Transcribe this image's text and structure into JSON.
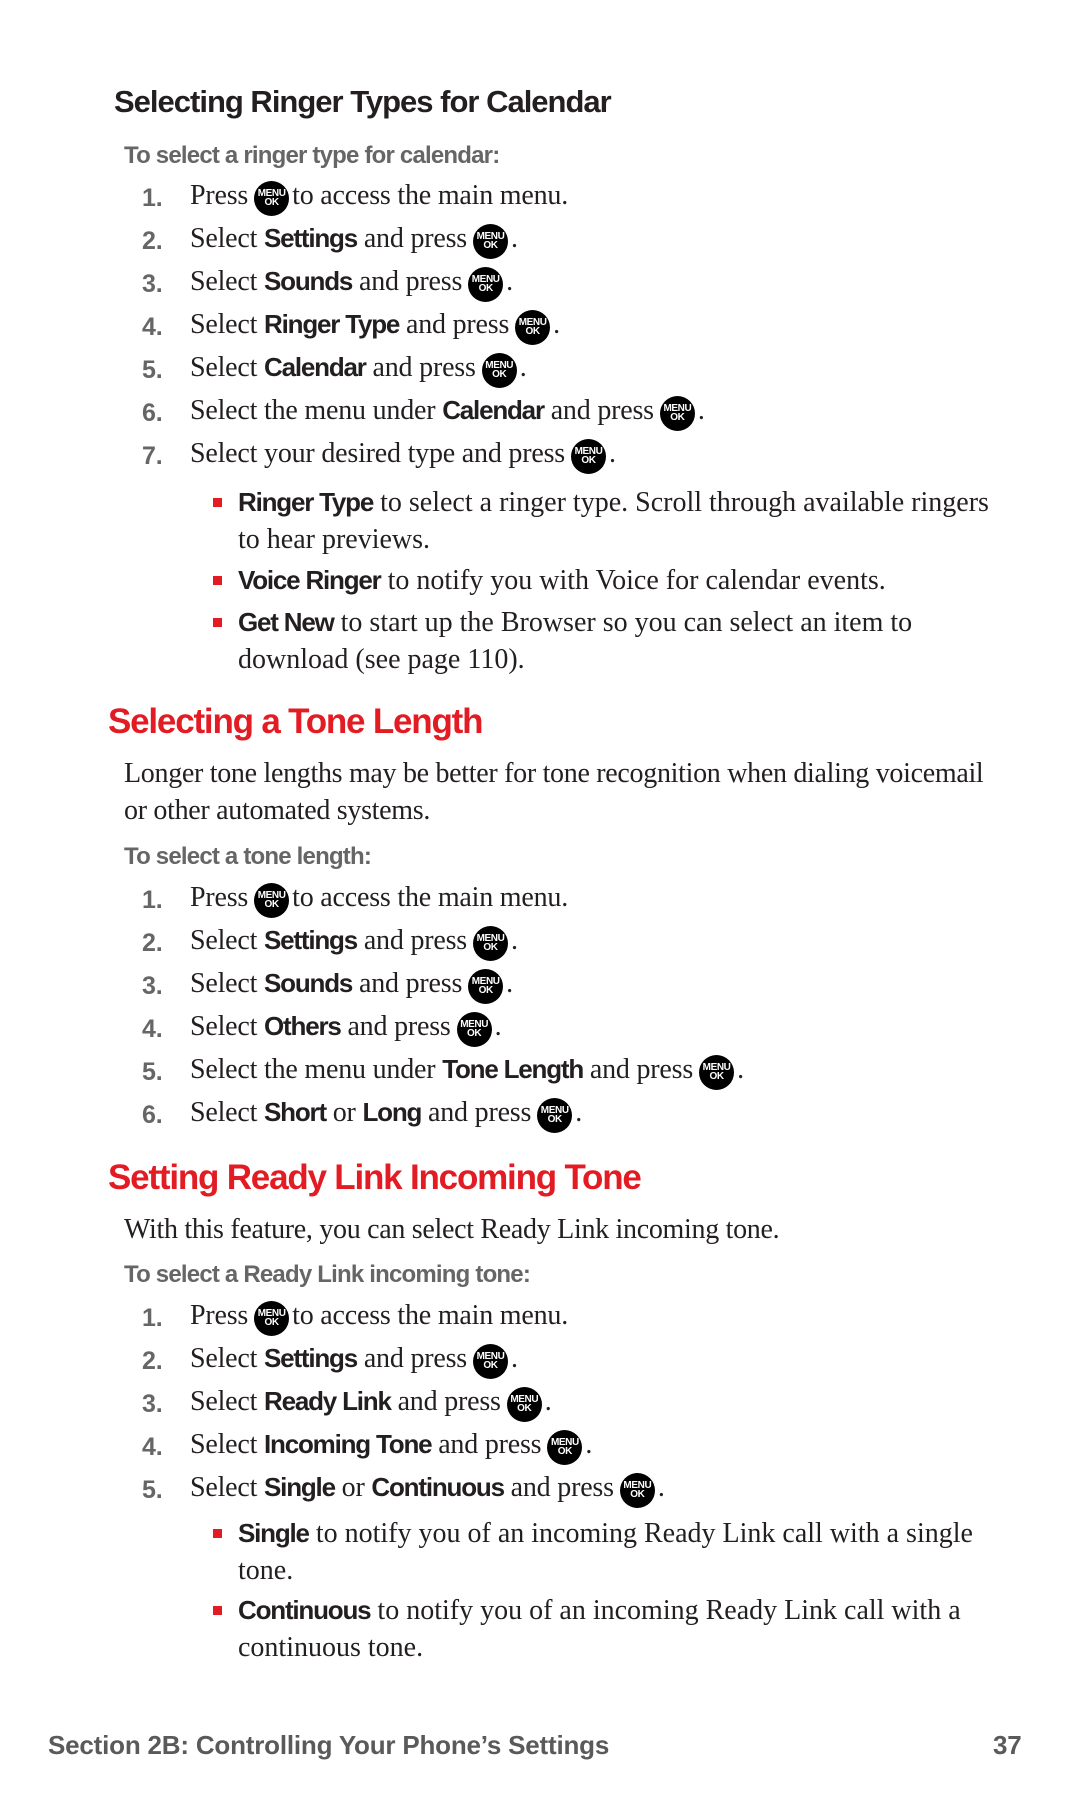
{
  "sections": [
    {
      "title": "Selecting Ringer Types for Calendar",
      "lead": "To select a ringer type for calendar:",
      "steps": [
        {
          "num": "1.",
          "pre": "Press",
          "kw1": "",
          "mid": "",
          "kw2": "",
          "post": "to access the main menu.",
          "end": ""
        },
        {
          "num": "2.",
          "pre": "Select",
          "kw1": "Settings",
          "mid": "",
          "kw2": "",
          "post": "and press",
          "end": "."
        },
        {
          "num": "3.",
          "pre": "Select",
          "kw1": "Sounds",
          "mid": "",
          "kw2": "",
          "post": "and press",
          "end": "."
        },
        {
          "num": "4.",
          "pre": "Select",
          "kw1": "Ringer Type",
          "mid": "",
          "kw2": "",
          "post": "and press",
          "end": "."
        },
        {
          "num": "5.",
          "pre": "Select",
          "kw1": "Calendar",
          "mid": "",
          "kw2": "",
          "post": "and press",
          "end": "."
        },
        {
          "num": "6.",
          "pre": "Select the menu under",
          "kw1": "Calendar",
          "mid": "",
          "kw2": "",
          "post": "and press",
          "end": "."
        },
        {
          "num": "7.",
          "pre": "Select your desired type and press",
          "kw1": "",
          "mid": "",
          "kw2": "",
          "post": "",
          "end": "."
        }
      ],
      "bullets": [
        {
          "kw": "Ringer Type",
          "text": "to select a ringer type. Scroll through available ringers to hear previews."
        },
        {
          "kw": "Voice Ringer",
          "text": "to notify you with Voice for calendar events."
        },
        {
          "kw": "Get New",
          "text": "to start up the Browser so you can select an item to download (see page 110)."
        }
      ]
    },
    {
      "title": "Selecting a Tone Length",
      "paragraph": "Longer tone lengths may be better for tone recognition when dialing voicemail or other automated systems.",
      "lead": "To select a tone length:",
      "steps": [
        {
          "num": "1.",
          "pre": "Press",
          "kw1": "",
          "mid": "",
          "kw2": "",
          "post": "to access the main menu.",
          "end": ""
        },
        {
          "num": "2.",
          "pre": "Select",
          "kw1": "Settings",
          "mid": "",
          "kw2": "",
          "post": "and press",
          "end": "."
        },
        {
          "num": "3.",
          "pre": "Select",
          "kw1": "Sounds",
          "mid": "",
          "kw2": "",
          "post": "and press",
          "end": "."
        },
        {
          "num": "4.",
          "pre": "Select",
          "kw1": "Others",
          "mid": "",
          "kw2": "",
          "post": "and press",
          "end": "."
        },
        {
          "num": "5.",
          "pre": "Select the menu under",
          "kw1": "Tone Length",
          "mid": "",
          "kw2": "",
          "post": "and press",
          "end": "."
        },
        {
          "num": "6.",
          "pre": "Select",
          "kw1": "Short",
          "mid": "or",
          "kw2": "Long",
          "post": "and press",
          "end": "."
        }
      ]
    },
    {
      "title": "Setting Ready Link Incoming Tone",
      "paragraph": "With this feature, you can select Ready Link incoming tone.",
      "lead": "To select a Ready Link incoming tone:",
      "steps": [
        {
          "num": "1.",
          "pre": "Press",
          "kw1": "",
          "mid": "",
          "kw2": "",
          "post": "to access the main menu.",
          "end": ""
        },
        {
          "num": "2.",
          "pre": "Select",
          "kw1": "Settings",
          "mid": "",
          "kw2": "",
          "post": "and press",
          "end": "."
        },
        {
          "num": "3.",
          "pre": "Select",
          "kw1": "Ready Link",
          "mid": "",
          "kw2": "",
          "post": "and press",
          "end": "."
        },
        {
          "num": "4.",
          "pre": "Select",
          "kw1": "Incoming Tone",
          "mid": "",
          "kw2": "",
          "post": "and press",
          "end": "."
        },
        {
          "num": "5.",
          "pre": "Select",
          "kw1": "Single",
          "mid": "or",
          "kw2": "Continuous",
          "post": "and press",
          "end": "."
        }
      ],
      "bullets": [
        {
          "kw": "Single",
          "text": "to notify you of an incoming Ready Link call with a single tone."
        },
        {
          "kw": "Continuous",
          "text": "to notify you of an incoming Ready Link call with a continuous tone."
        }
      ]
    }
  ],
  "menu_key": {
    "icon": "menu-ok-key-icon",
    "line1": "MENU",
    "line2": "OK"
  },
  "footer": {
    "section": "Section 2B: Controlling Your Phone’s Settings",
    "page": "37"
  },
  "colors": {
    "heading_red": "#e31b23",
    "lead_gray": "#666666",
    "text": "#231f20",
    "footer_gray": "#5a5a5a"
  }
}
